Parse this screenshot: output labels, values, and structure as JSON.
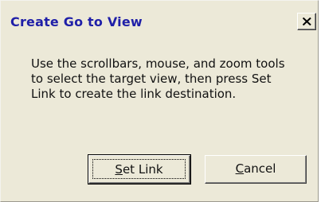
{
  "dialog": {
    "title": "Create Go to View",
    "close_symbol": "×",
    "message": "Use the scrollbars, mouse, and zoom tools to select the target view, then press Set Link to create the link destination.",
    "buttons": {
      "set_link": {
        "mnemonic": "S",
        "rest": "et Link"
      },
      "cancel": {
        "mnemonic": "C",
        "rest": "ancel"
      }
    },
    "colors": {
      "title_text": "#1f1fa8",
      "dialog_bg": "#ece9d8"
    }
  }
}
